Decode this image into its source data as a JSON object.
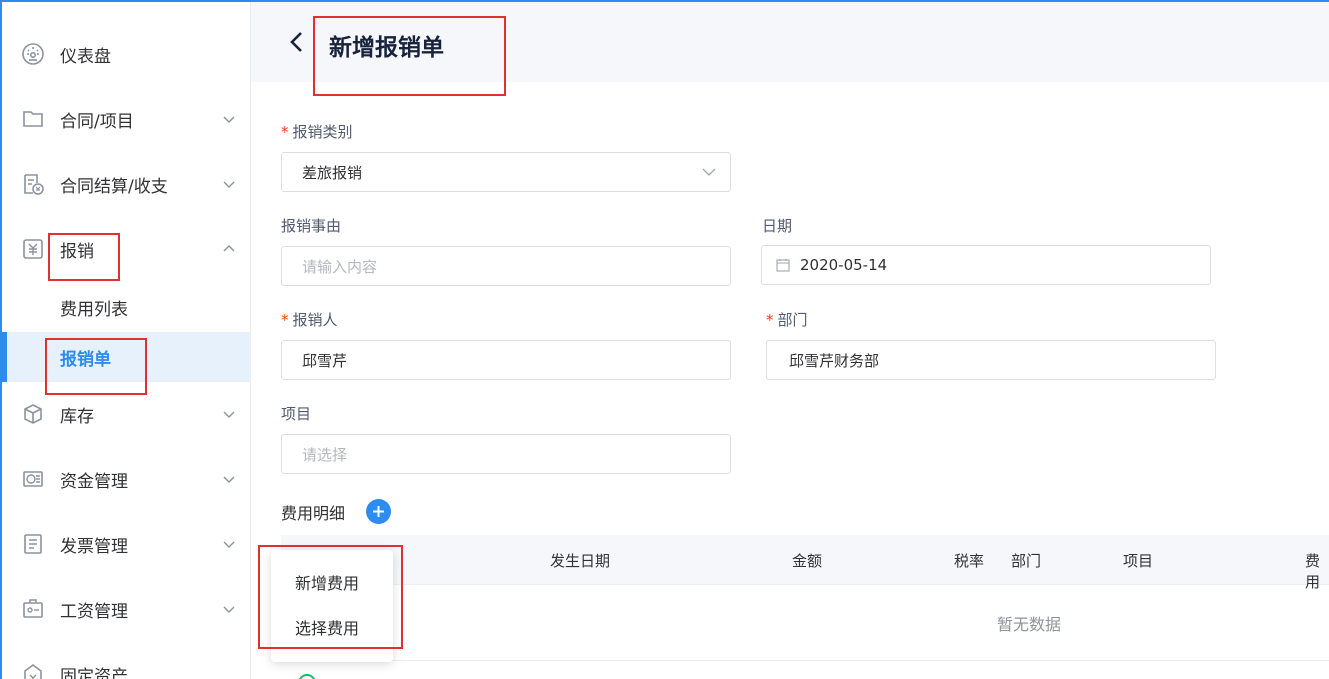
{
  "sidebar": {
    "items": [
      {
        "label": "仪表盘",
        "icon": "dashboard-icon",
        "has_arrow": false
      },
      {
        "label": "合同/项目",
        "icon": "folder-icon",
        "has_arrow": true
      },
      {
        "label": "合同结算/收支",
        "icon": "settlement-icon",
        "has_arrow": true
      },
      {
        "label": "报销",
        "icon": "yen-icon",
        "has_arrow": true,
        "expanded": true
      },
      {
        "label": "库存",
        "icon": "box-icon",
        "has_arrow": true
      },
      {
        "label": "资金管理",
        "icon": "fund-icon",
        "has_arrow": true
      },
      {
        "label": "发票管理",
        "icon": "invoice-icon",
        "has_arrow": true
      },
      {
        "label": "工资管理",
        "icon": "salary-icon",
        "has_arrow": true
      },
      {
        "label": "固定资产",
        "icon": "asset-icon",
        "has_arrow": false
      }
    ],
    "sub_items": [
      {
        "label": "费用列表",
        "active": false
      },
      {
        "label": "报销单",
        "active": true
      }
    ]
  },
  "header": {
    "title": "新增报销单"
  },
  "form": {
    "category": {
      "label": "报销类别",
      "required": true,
      "value": "差旅报销"
    },
    "reason": {
      "label": "报销事由",
      "placeholder": "请输入内容"
    },
    "date": {
      "label": "日期",
      "value": "2020-05-14"
    },
    "person": {
      "label": "报销人",
      "required": true,
      "value": "邱雪芹"
    },
    "department": {
      "label": "部门",
      "required": true,
      "value": "邱雪芹财务部"
    },
    "project": {
      "label": "项目",
      "placeholder": "请选择"
    }
  },
  "details": {
    "title": "费用明细",
    "columns": [
      "发生日期",
      "金额",
      "税率",
      "部门",
      "项目",
      "费用"
    ],
    "empty_text": "暂无数据",
    "dropdown": [
      "新增费用",
      "选择费用"
    ]
  },
  "colors": {
    "accent": "#2d8cf0",
    "annotation": "#e03131",
    "required": "#ed4014"
  }
}
